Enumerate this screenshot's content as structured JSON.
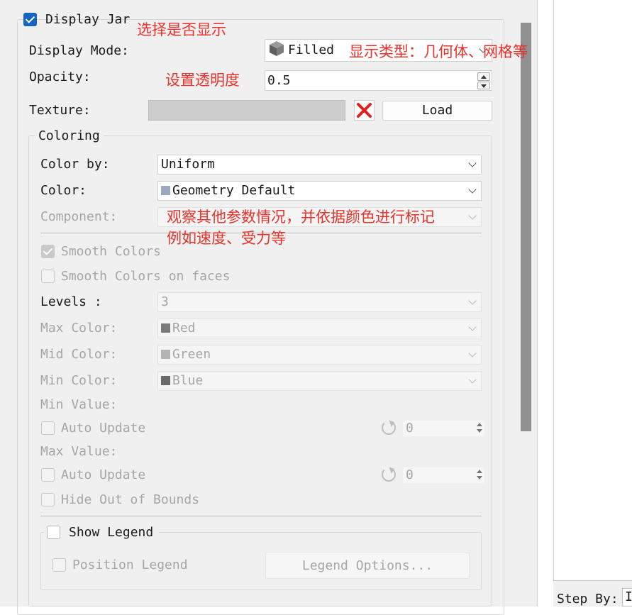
{
  "display_jar": {
    "label": "Display Jar",
    "checked": true
  },
  "display_mode": {
    "label": "Display Mode:",
    "value": "Filled",
    "icon": "cube-icon"
  },
  "opacity": {
    "label": "Opacity:",
    "value": "0.5"
  },
  "texture": {
    "label": "Texture:",
    "load_label": "Load",
    "clear_icon": "red-x-icon"
  },
  "coloring": {
    "title": "Coloring",
    "color_by": {
      "label": "Color by:",
      "value": "Uniform"
    },
    "color": {
      "label": "Color:",
      "value": "Geometry Default",
      "swatch": "#9aa9bd"
    },
    "component": {
      "label": "Component:",
      "value": ""
    },
    "smooth_colors": {
      "label": "Smooth Colors",
      "checked": true
    },
    "smooth_colors_faces": {
      "label": "Smooth Colors on faces",
      "checked": false
    },
    "levels": {
      "label": "Levels :",
      "value": "3"
    },
    "max_color": {
      "label": "Max Color:",
      "value": "Red",
      "swatch": "#7a7a7a"
    },
    "mid_color": {
      "label": "Mid Color:",
      "value": "Green",
      "swatch": "#b4b4b4"
    },
    "min_color": {
      "label": "Min Color:",
      "value": "Blue",
      "swatch": "#6a6a6a"
    },
    "min_value": {
      "label": "Min Value:",
      "auto_label": "Auto Update",
      "value": "0"
    },
    "max_value": {
      "label": "Max Value:",
      "auto_label": "Auto Update",
      "value": "0"
    },
    "hide_out_of_bounds": {
      "label": "Hide Out of Bounds"
    }
  },
  "legend": {
    "show_label": "Show Legend",
    "position_label": "Position Legend",
    "options_label": "Legend Options..."
  },
  "annotations": {
    "display_note": "选择是否显示",
    "mode_note": "显示类型：几何体、网格等",
    "opacity_note": "设置透明度",
    "coloring_note_1": "观察其他参数情况，并依据颜色进行标记",
    "coloring_note_2": "例如速度、受力等"
  },
  "step_by": {
    "label": "Step By:",
    "value": "I"
  }
}
